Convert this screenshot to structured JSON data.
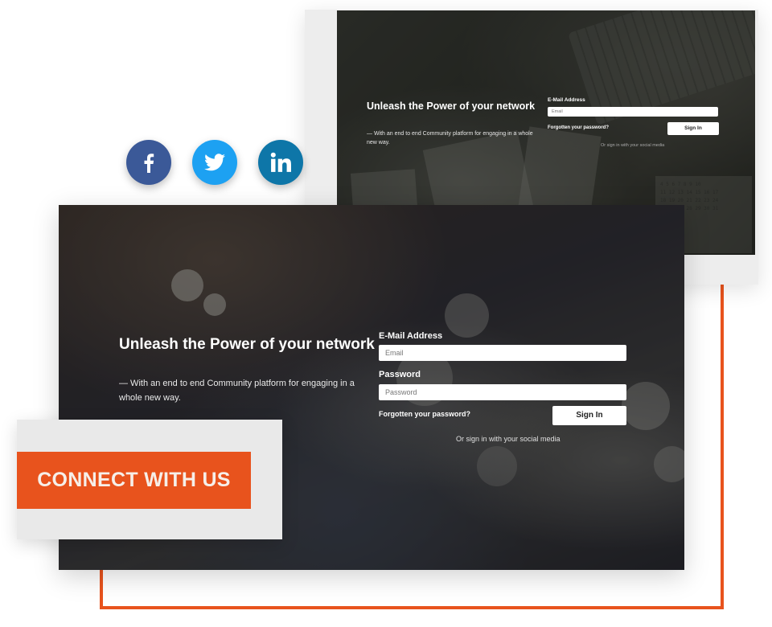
{
  "colors": {
    "accent": "#e8531d",
    "facebook": "#3b5998",
    "twitter": "#1da1f2",
    "linkedin": "#0e76a8"
  },
  "social": [
    {
      "name": "facebook",
      "icon": "facebook-icon"
    },
    {
      "name": "twitter",
      "icon": "twitter-icon"
    },
    {
      "name": "linkedin",
      "icon": "linkedin-icon"
    }
  ],
  "preview_small": {
    "title": "Unleash the Power of your network",
    "subtitle": "— With an end to end Community platform for engaging in a whole new way.",
    "email_label": "E-Mail Address",
    "email_placeholder": "Email",
    "forgot": "Forgotten your password?",
    "signin": "Sign In",
    "social_text": "Or sign in with your social media"
  },
  "preview_main": {
    "title": "Unleash the Power of your network",
    "subtitle": "— With an end to end Community platform for engaging in a whole new way.",
    "email_label": "E-Mail Address",
    "email_placeholder": "Email",
    "password_label": "Password",
    "password_placeholder": "Password",
    "forgot": "Forgotten your password?",
    "signin": "Sign In",
    "social_text": "Or sign in with your social media"
  },
  "cta": {
    "label": "CONNECT WITH US"
  }
}
